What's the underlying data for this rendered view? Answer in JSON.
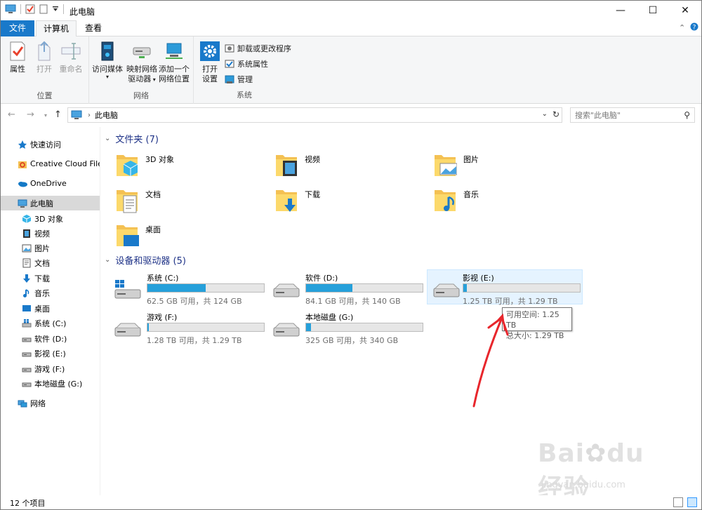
{
  "window": {
    "title": "此电脑"
  },
  "tabs": {
    "file": "文件",
    "computer": "计算机",
    "view": "查看"
  },
  "ribbon": {
    "location": {
      "label": "位置",
      "properties": "属性",
      "open": "打开",
      "rename": "重命名"
    },
    "network": {
      "label": "网络",
      "access_media": "访问媒体",
      "map_drive_1": "映射网络",
      "map_drive_2": "驱动器",
      "add_location_1": "添加一个",
      "add_location_2": "网络位置"
    },
    "system": {
      "label": "系统",
      "open_settings_1": "打开",
      "open_settings_2": "设置",
      "uninstall": "卸载或更改程序",
      "system_properties": "系统属性",
      "manage": "管理"
    }
  },
  "address": {
    "crumb": "此电脑",
    "search_placeholder": "搜索\"此电脑\""
  },
  "nav": [
    {
      "label": "快速访问",
      "icon": "star-icon"
    },
    {
      "label": "Creative Cloud Files",
      "icon": "creative-cloud-icon"
    },
    {
      "label": "OneDrive",
      "icon": "onedrive-icon"
    },
    {
      "label": "此电脑",
      "icon": "pc-icon"
    },
    {
      "label": "3D 对象",
      "icon": "3d-objects-icon"
    },
    {
      "label": "视频",
      "icon": "video-icon"
    },
    {
      "label": "图片",
      "icon": "picture-icon"
    },
    {
      "label": "文档",
      "icon": "document-icon"
    },
    {
      "label": "下载",
      "icon": "download-icon"
    },
    {
      "label": "音乐",
      "icon": "music-icon"
    },
    {
      "label": "桌面",
      "icon": "desktop-icon"
    },
    {
      "label": "系统 (C:)",
      "icon": "drive-icon"
    },
    {
      "label": "软件 (D:)",
      "icon": "drive-icon"
    },
    {
      "label": "影视 (E:)",
      "icon": "drive-icon"
    },
    {
      "label": "游戏 (F:)",
      "icon": "drive-icon"
    },
    {
      "label": "本地磁盘 (G:)",
      "icon": "drive-icon"
    },
    {
      "label": "网络",
      "icon": "network-icon"
    }
  ],
  "folders_section": {
    "title": "文件夹 (7)"
  },
  "folders": [
    {
      "name": "3D 对象",
      "icon": "3d-objects-icon"
    },
    {
      "name": "视频",
      "icon": "video-icon"
    },
    {
      "name": "图片",
      "icon": "picture-icon"
    },
    {
      "name": "文档",
      "icon": "document-icon"
    },
    {
      "name": "下载",
      "icon": "download-icon"
    },
    {
      "name": "音乐",
      "icon": "music-icon"
    },
    {
      "name": "桌面",
      "icon": "desktop-icon"
    }
  ],
  "drives_section": {
    "title": "设备和驱动器 (5)"
  },
  "drives": [
    {
      "name": "系统 (C:)",
      "info": "62.5 GB 可用，共 124 GB",
      "used_fraction": 0.5
    },
    {
      "name": "软件 (D:)",
      "info": "84.1 GB 可用，共 140 GB",
      "used_fraction": 0.4
    },
    {
      "name": "影视 (E:)",
      "info": "1.25 TB 可用，共 1.29 TB",
      "used_fraction": 0.03
    },
    {
      "name": "游戏 (F:)",
      "info": "1.28 TB 可用，共 1.29 TB",
      "used_fraction": 0.01
    },
    {
      "name": "本地磁盘 (G:)",
      "info": "325 GB 可用，共 340 GB",
      "used_fraction": 0.04
    }
  ],
  "tooltip": {
    "line1": "可用空间: 1.25 TB",
    "line2": "总大小: 1.29 TB"
  },
  "status": {
    "count": "12 个项目"
  },
  "watermark": {
    "logo": "Bai du 经验",
    "url": "jingyan.baidu.com"
  },
  "colors": {
    "accent": "#1979ca",
    "bar_fill": "#26a0da",
    "section_title": "#1e3287",
    "arrow": "#e8262c"
  }
}
